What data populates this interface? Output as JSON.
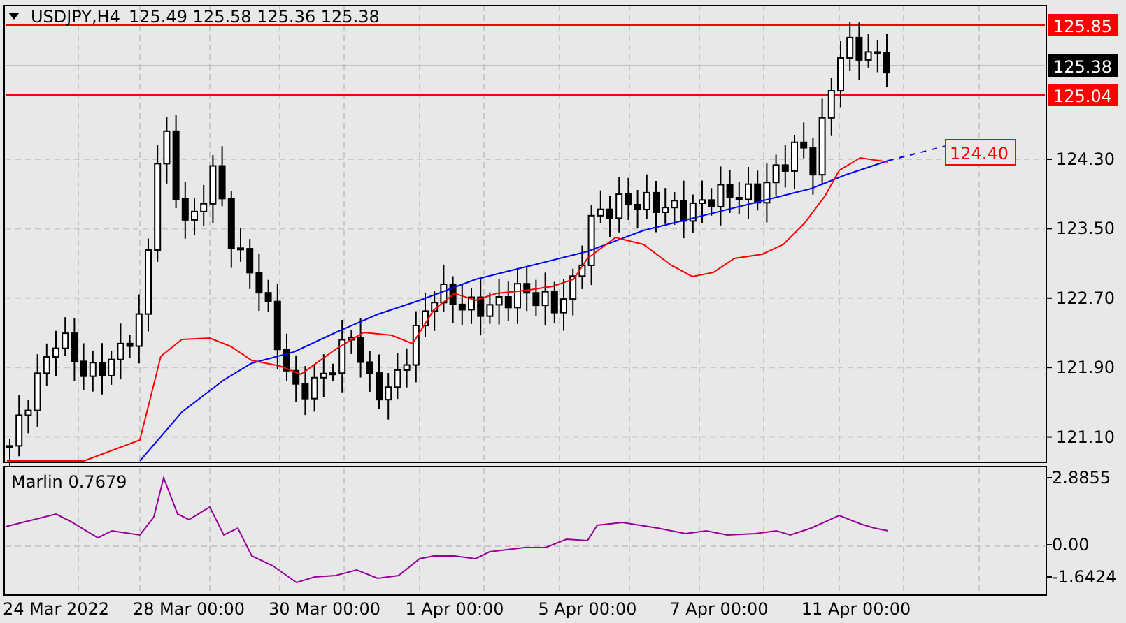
{
  "header": {
    "symbol": "USDJPY,H4",
    "ohlc": "125.49 125.58 125.36 125.38"
  },
  "price_axis": {
    "ticks": [
      "124.30",
      "123.50",
      "122.70",
      "121.90",
      "121.10"
    ]
  },
  "price_tags": [
    {
      "label": "125.85",
      "kind": "level"
    },
    {
      "label": "125.38",
      "kind": "current"
    },
    {
      "label": "125.04",
      "kind": "level"
    }
  ],
  "target_label": "124.40",
  "indicator": {
    "name": "Marlin 0.7679",
    "ticks": [
      "2.8855",
      "0.00",
      "-1.6424"
    ]
  },
  "time_axis": [
    "24 Mar 2022",
    "28 Mar 00:00",
    "30 Mar 00:00",
    "1 Apr 00:00",
    "5 Apr 00:00",
    "7 Apr 00:00",
    "11 Apr 00:00"
  ]
}
